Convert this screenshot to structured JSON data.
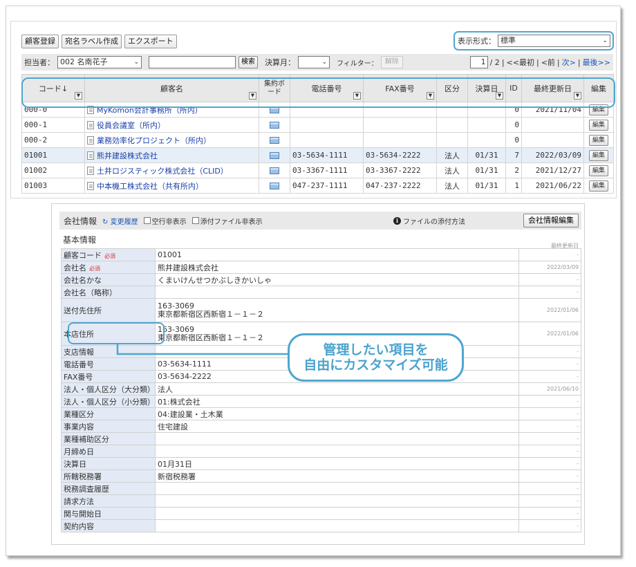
{
  "toolbar": {
    "register_label": "顧客登録",
    "label_create_label": "宛名ラベル作成",
    "export_label": "エクスポート"
  },
  "display_format": {
    "label": "表示形式：",
    "value": "標準"
  },
  "filters": {
    "owner_label": "担当者：",
    "owner_value": "002 名南花子",
    "search_value": "",
    "search_button": "検索",
    "fiscal_month_label": "決算月：",
    "fiscal_month_value": "",
    "filter_label": "フィルター：",
    "clear_button": "解除"
  },
  "pager": {
    "page": "1",
    "total": "/ 2",
    "sep": "|",
    "first": "<<最初",
    "prev": "<前",
    "next": "次>",
    "last": "最後>>"
  },
  "grid": {
    "headers": {
      "code": "コード↓",
      "name": "顧客名",
      "board": "集約ボード",
      "tel": "電話番号",
      "fax": "FAX番号",
      "type": "区分",
      "closing": "決算日",
      "id": "ID",
      "updated": "最終更新日",
      "edit": "編集"
    },
    "edit_label": "編集",
    "rows": [
      {
        "code": "000-0",
        "name": "MyKomon会計事務所（所内）",
        "tel": "",
        "fax": "",
        "type": "",
        "closing": "",
        "id": "0",
        "updated": "2021/11/04"
      },
      {
        "code": "000-1",
        "name": "役員会議室（所内）",
        "tel": "",
        "fax": "",
        "type": "",
        "closing": "",
        "id": "0",
        "updated": ""
      },
      {
        "code": "000-2",
        "name": "業務効率化プロジェクト（所内）",
        "tel": "",
        "fax": "",
        "type": "",
        "closing": "",
        "id": "0",
        "updated": ""
      },
      {
        "code": "01001",
        "name": "熊井建設株式会社",
        "tel": "03-5634-1111",
        "fax": "03-5634-2222",
        "type": "法人",
        "closing": "01/31",
        "id": "7",
        "updated": "2022/03/09"
      },
      {
        "code": "01002",
        "name": "土井ロジスティック株式会社（CLID）",
        "tel": "03-3367-1111",
        "fax": "03-3367-2222",
        "type": "法人",
        "closing": "01/31",
        "id": "2",
        "updated": "2021/12/27"
      },
      {
        "code": "01003",
        "name": "中本機工株式会社（共有所内）",
        "tel": "047-237-1111",
        "fax": "047-237-2222",
        "type": "法人",
        "closing": "01/31",
        "id": "1",
        "updated": "2021/06/22"
      }
    ]
  },
  "company_info": {
    "title": "会社情報",
    "history_link": "変更履歴",
    "hide_empty_label": "空行非表示",
    "hide_attachments_label": "添付ファイル非表示",
    "attach_howto": "ファイルの添付方法",
    "edit_button": "会社情報編集",
    "section_title": "基本情報",
    "last_updated_header": "最終更新日",
    "required_mark": "必須",
    "rows": [
      {
        "key": "顧客コード",
        "value": "01001",
        "date": "-",
        "required": true
      },
      {
        "key": "会社名",
        "value": "熊井建設株式会社",
        "date": "2022/03/09",
        "required": true
      },
      {
        "key": "会社名かな",
        "value": "くまいけんせつかぶしきかいしゃ",
        "date": "-"
      },
      {
        "key": "会社名（略称）",
        "value": "",
        "date": "-"
      },
      {
        "key": "送付先住所",
        "value": "163-3069",
        "value2": "東京都新宿区西新宿１－１－２",
        "date": "2022/01/06"
      },
      {
        "key": "本店住所",
        "value": "163-3069",
        "value2": "東京都新宿区西新宿１－１－２",
        "date": "2022/01/06"
      },
      {
        "key": "支店情報",
        "value": "",
        "date": "-"
      },
      {
        "key": "電話番号",
        "value": "03-5634-1111",
        "date": "-"
      },
      {
        "key": "FAX番号",
        "value": "03-5634-2222",
        "date": "-"
      },
      {
        "key": "法人・個人区分（大分類）",
        "value": "法人",
        "date": "2021/06/10"
      },
      {
        "key": "法人・個人区分（小分類）",
        "value": "01:株式会社",
        "date": "-"
      },
      {
        "key": "業種区分",
        "value": "04:建設業・土木業",
        "date": "-"
      },
      {
        "key": "事業内容",
        "value": "住宅建設",
        "date": "-"
      },
      {
        "key": "業種補助区分",
        "value": "",
        "date": "-"
      },
      {
        "key": "月締め日",
        "value": "",
        "date": "-"
      },
      {
        "key": "決算日",
        "value": "01月31日",
        "date": "-"
      },
      {
        "key": "所轄税務署",
        "value": "新宿税務署",
        "date": "-"
      },
      {
        "key": "税務調査履歴",
        "value": "",
        "date": "-"
      },
      {
        "key": "請求方法",
        "value": "",
        "date": "-"
      },
      {
        "key": "関与開始日",
        "value": "",
        "date": "-"
      },
      {
        "key": "契約内容",
        "value": "",
        "date": "-"
      }
    ]
  },
  "callout": {
    "line1": "管理したい項目を",
    "line2": "自由にカスタマイズ可能"
  },
  "colors": {
    "accent": "#4ea6cf",
    "link": "#1a56b8",
    "row_highlight": "#e6eef7",
    "key_cell": "#e3eaf5"
  }
}
